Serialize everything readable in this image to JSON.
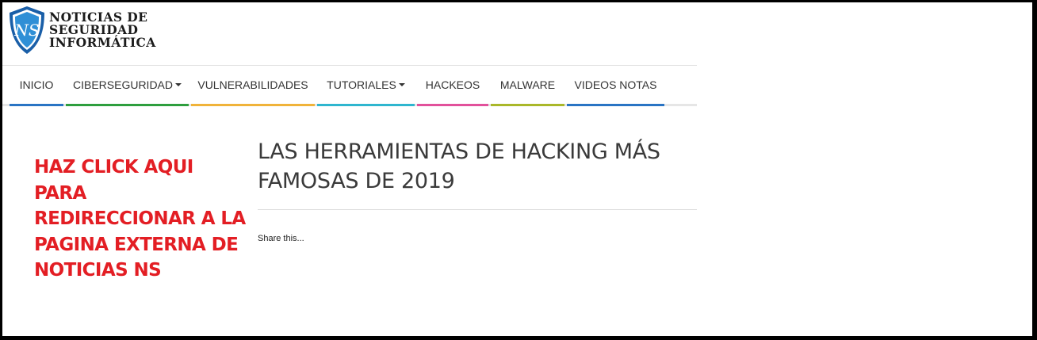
{
  "site": {
    "logo_monogram": "NS",
    "logo_lines": [
      "NOTICIAS DE",
      "SEGURIDAD",
      "INFORMÁTICA"
    ]
  },
  "nav": {
    "items": [
      {
        "label": "INICIO",
        "dropdown": false,
        "color": "#2a74c4"
      },
      {
        "label": "CIBERSEGURIDAD",
        "dropdown": true,
        "color": "#2e9e3e"
      },
      {
        "label": "VULNERABILIDADES",
        "dropdown": false,
        "color": "#f0b33a"
      },
      {
        "label": "TUTORIALES",
        "dropdown": true,
        "color": "#2fb6cf"
      },
      {
        "label": "HACKEOS",
        "dropdown": false,
        "color": "#e2519b"
      },
      {
        "label": "MALWARE",
        "dropdown": false,
        "color": "#aab82a"
      },
      {
        "label": "VIDEOS NOTAS",
        "dropdown": false,
        "color": "#2a74c4"
      }
    ]
  },
  "promo": {
    "text": "HAZ CLICK AQUI PARA REDIRECCIONAR A LA PAGINA EXTERNA DE NOTICIAS NS",
    "color": "#e31e24"
  },
  "article": {
    "title": "LAS HERRAMIENTAS DE HACKING MÁS FAMOSAS DE 2019",
    "share_text": "Share this..."
  },
  "colors": {
    "logo_shield": "#2f8fd6",
    "logo_shield_dark": "#1a5fa8"
  }
}
